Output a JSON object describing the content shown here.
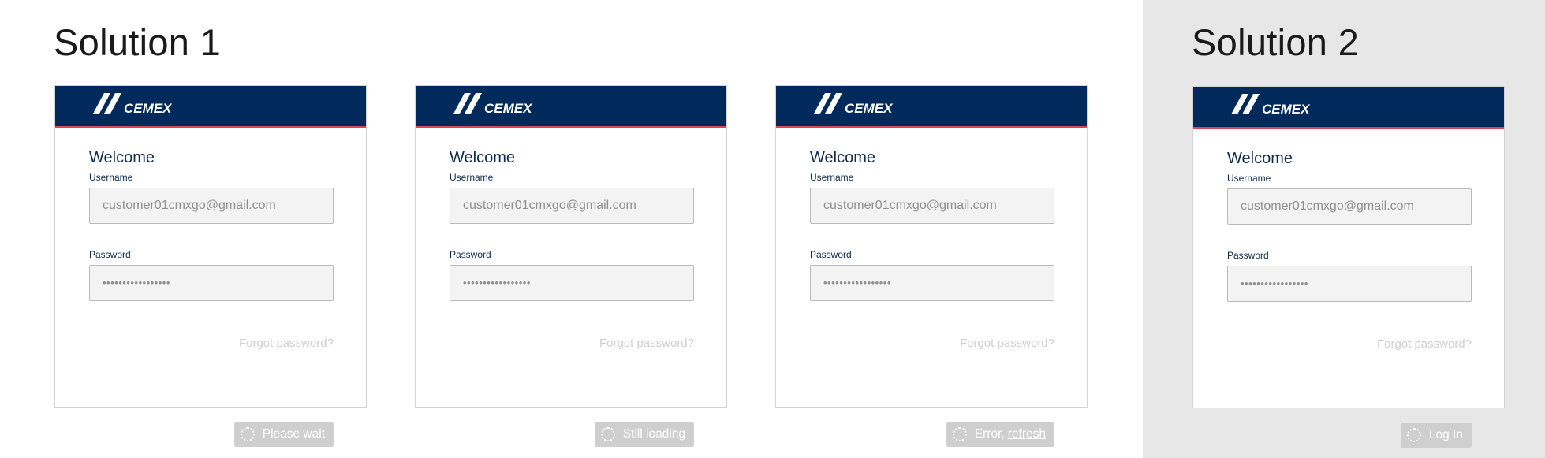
{
  "solutions": [
    {
      "title": "Solution 1"
    },
    {
      "title": "Solution 2"
    }
  ],
  "brand": {
    "logo_text": "CEMEX",
    "header_color": "#002a5c",
    "accent_color": "#d9455a"
  },
  "cards": [
    {
      "welcome": "Welcome",
      "username_label": "Username",
      "username_value": "customer01cmxgo@gmail.com",
      "password_label": "Password",
      "password_value": "•••••••••••••••••",
      "forgot": "Forgot password?",
      "button_label": "Please wait"
    },
    {
      "welcome": "Welcome",
      "username_label": "Username",
      "username_value": "customer01cmxgo@gmail.com",
      "password_label": "Password",
      "password_value": "•••••••••••••••••",
      "forgot": "Forgot password?",
      "button_label": "Still loading"
    },
    {
      "welcome": "Welcome",
      "username_label": "Username",
      "username_value": "customer01cmxgo@gmail.com",
      "password_label": "Password",
      "password_value": "•••••••••••••••••",
      "forgot": "Forgot password?",
      "button_label": "Error,",
      "button_link": "refresh"
    },
    {
      "welcome": "Welcome",
      "username_label": "Username",
      "username_value": "customer01cmxgo@gmail.com",
      "password_label": "Password",
      "password_value": "•••••••••••••••••",
      "forgot": "Forgot password?",
      "button_label": "Log In"
    }
  ]
}
